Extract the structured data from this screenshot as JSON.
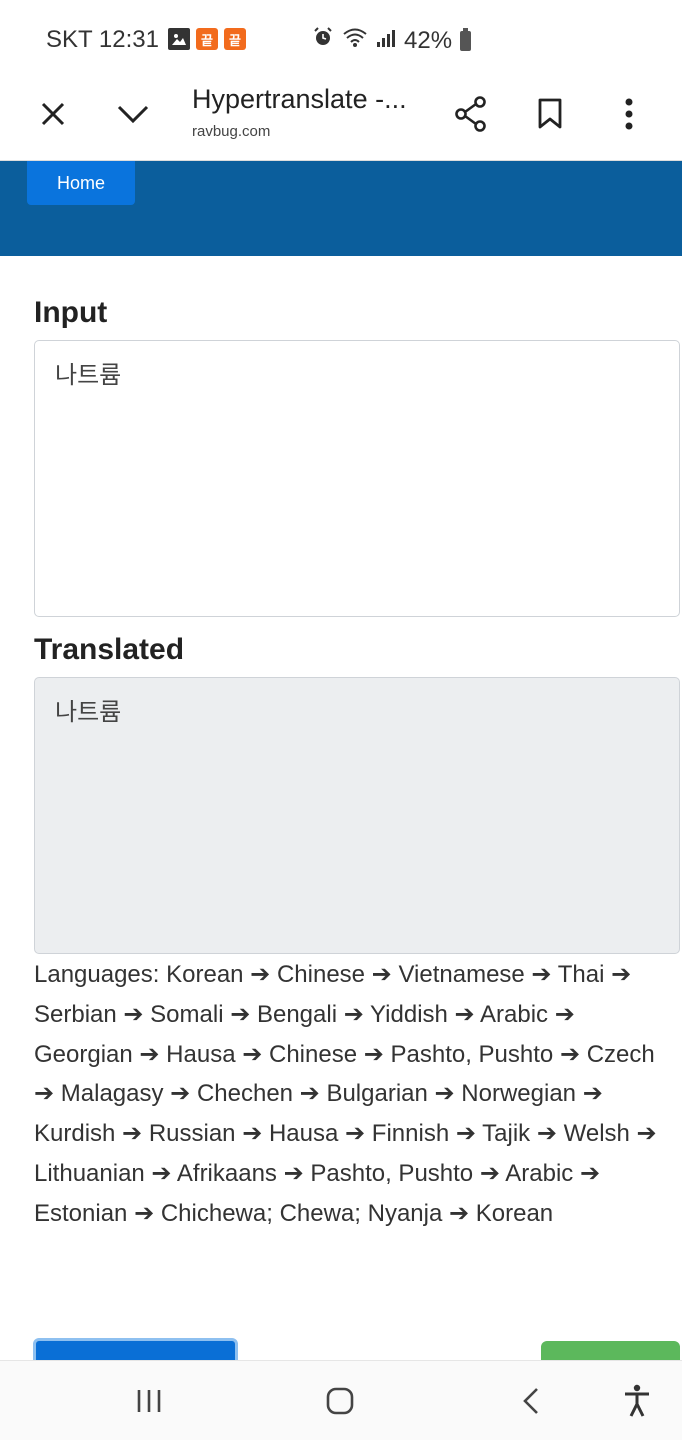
{
  "status_bar": {
    "carrier_time": "SKT 12:31",
    "app_icon_char": "끝",
    "battery": "42%"
  },
  "toolbar": {
    "title": "Hypertranslate -...",
    "url": "ravbug.com"
  },
  "site": {
    "home_label": "Home"
  },
  "main": {
    "input_label": "Input",
    "input_value": "나트륨",
    "translated_label": "Translated",
    "translated_value": "나트륨",
    "languages_text": "Languages: Korean ➔ Chinese ➔ Vietnamese ➔ Thai ➔ Serbian ➔ Somali ➔ Bengali ➔ Yiddish ➔ Arabic ➔ Georgian ➔ Hausa ➔ Chinese ➔ Pashto, Pushto ➔ Czech ➔ Malagasy ➔ Chechen ➔ Bulgarian ➔ Norwegian ➔ Kurdish ➔ Russian ➔ Hausa ➔ Finnish ➔ Tajik ➔ Welsh ➔ Lithuanian ➔ Afrikaans ➔ Pashto, Pushto ➔ Arabic ➔ Estonian ➔ Chichewa; Chewa; Nyanja ➔ Korean"
  },
  "colors": {
    "header_blue": "#0b5e9c",
    "home_button": "#0a74dd",
    "output_bg": "#eceef0",
    "button_blue": "#0a6fd6",
    "button_green": "#5cb85c"
  },
  "icons": {
    "toolbar": [
      "close-icon",
      "chevron-down-icon",
      "share-icon",
      "bookmark-icon",
      "more-vert-icon"
    ],
    "status": [
      "photo-icon",
      "app-icon",
      "alarm-icon",
      "wifi-icon",
      "signal-icon",
      "battery-icon"
    ],
    "nav": [
      "recents-icon",
      "home-icon",
      "back-icon",
      "accessibility-icon"
    ]
  }
}
